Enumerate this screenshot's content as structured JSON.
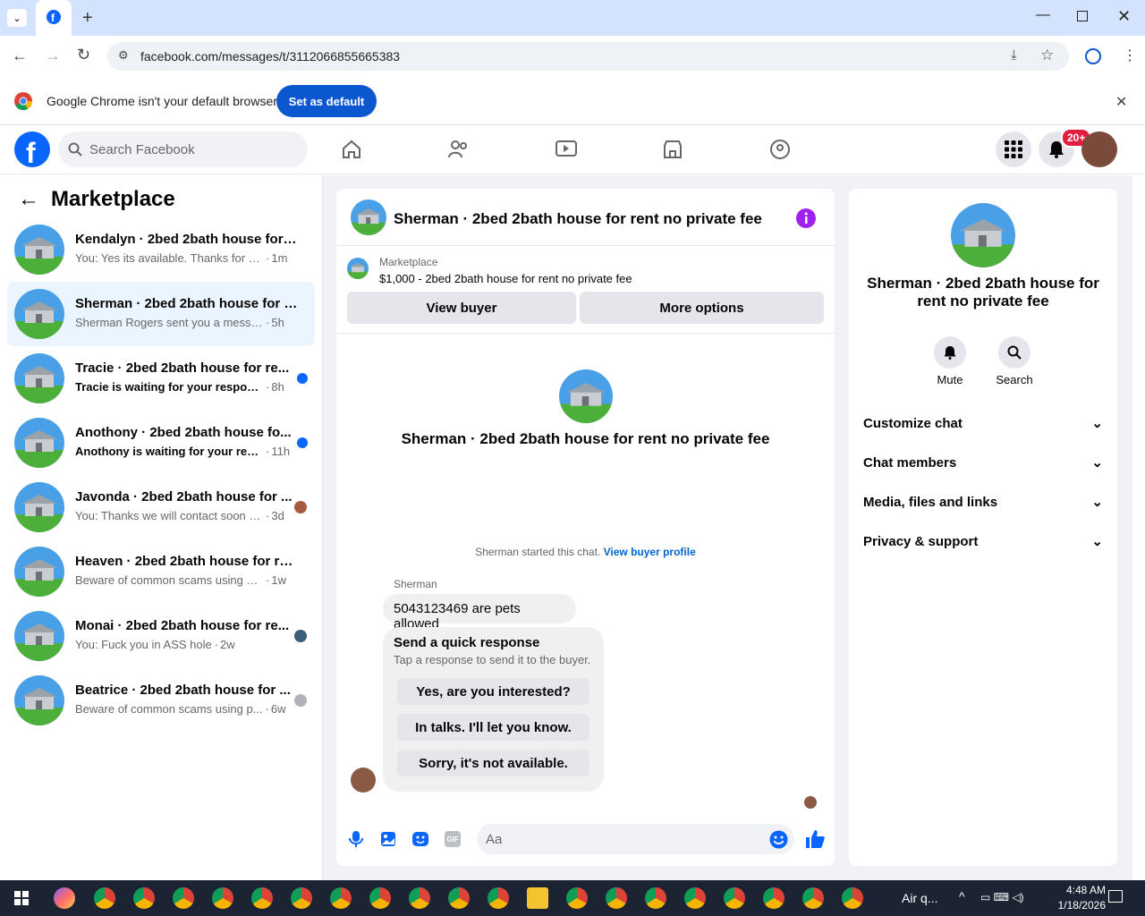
{
  "browser": {
    "url": "facebook.com/messages/t/3112066855665383",
    "infobar_text": "Google Chrome isn't your default browser",
    "set_default_label": "Set as default"
  },
  "fb": {
    "search_placeholder": "Search Facebook",
    "notif_badge": "20+"
  },
  "left": {
    "title": "Marketplace",
    "conversations": [
      {
        "name": "Kendalyn · 2bed 2bath house for r...",
        "preview": "You: Yes its available. Thanks for reac...",
        "time": "1m",
        "unread": false,
        "selected": false
      },
      {
        "name": "Sherman · 2bed 2bath house for r...",
        "preview": "Sherman Rogers sent you a message ...",
        "time": "5h",
        "unread": false,
        "selected": true
      },
      {
        "name": "Tracie · 2bed 2bath house for re...",
        "preview": "Tracie is waiting for your response.",
        "time": "8h",
        "unread": true,
        "selected": false
      },
      {
        "name": "Anothony · 2bed 2bath house fo...",
        "preview": "Anothony is waiting for your resp...",
        "time": "11h",
        "unread": true,
        "selected": false
      },
      {
        "name": "Javonda · 2bed 2bath house for ...",
        "preview": "You: Thanks we will contact soon w...",
        "time": "3d",
        "unread": false,
        "selected": false
      },
      {
        "name": "Heaven · 2bed 2bath house for ren...",
        "preview": "Beware of common scams using pay...",
        "time": "1w",
        "unread": false,
        "selected": false
      },
      {
        "name": "Monai · 2bed 2bath house for re...",
        "preview": "You: Fuck you in ASS hole",
        "time": "2w",
        "unread": false,
        "selected": false
      },
      {
        "name": "Beatrice · 2bed 2bath house for ...",
        "preview": "Beware of common scams using p...",
        "time": "6w",
        "unread": false,
        "selected": false
      }
    ]
  },
  "chat": {
    "header_title": "Sherman · 2bed 2bath house for rent no private fee",
    "listing_label": "Marketplace",
    "listing_text": "$1,000 - 2bed 2bath house for rent no private fee",
    "view_buyer": "View buyer",
    "more_options": "More options",
    "center_title": "Sherman · 2bed 2bath house for rent no private fee",
    "started_text": "Sherman started this chat.",
    "view_profile": "View buyer profile",
    "sender": "Sherman",
    "message": "5043123469 are pets allowed",
    "quick_title": "Send a quick response",
    "quick_sub": "Tap a response to send it to the buyer.",
    "quick_options": [
      "Yes, are you interested?",
      "In talks. I'll let you know.",
      "Sorry, it's not available."
    ],
    "composer_placeholder": "Aa"
  },
  "info": {
    "title": "Sherman · 2bed 2bath house for rent no private fee",
    "mute": "Mute",
    "search": "Search",
    "sections": [
      "Customize chat",
      "Chat members",
      "Media, files and links",
      "Privacy & support"
    ]
  },
  "taskbar": {
    "weather": "Air q...",
    "time": "4:48 AM",
    "date": "1/18/2026"
  },
  "colors": {
    "fb_blue": "#0866ff",
    "chrome_blue": "#0b57d0",
    "badge_red": "#e41e3f"
  }
}
